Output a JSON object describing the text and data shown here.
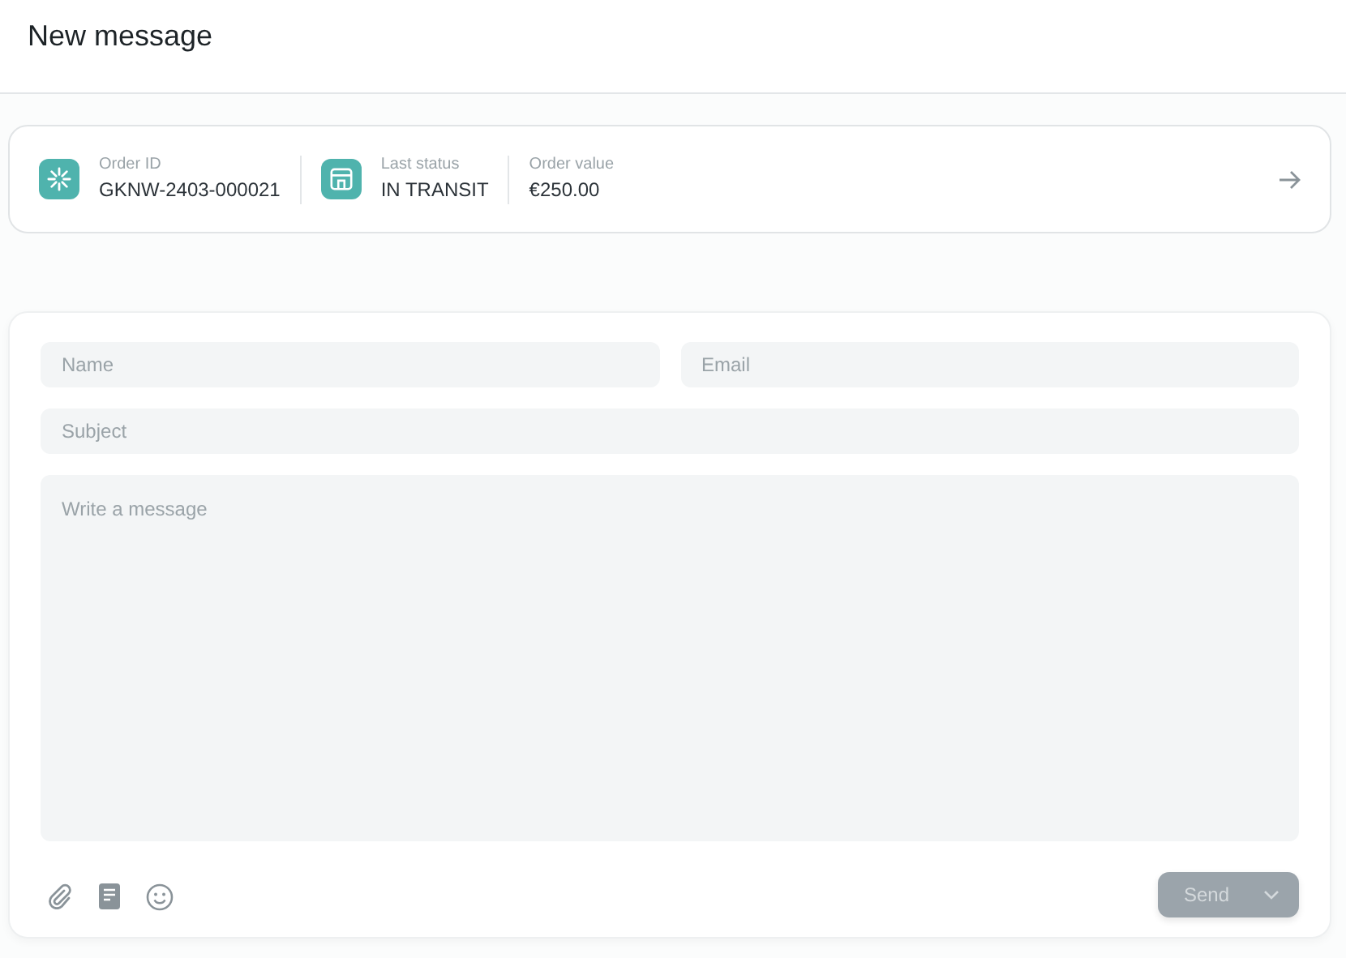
{
  "header": {
    "title": "New message"
  },
  "order": {
    "items": [
      {
        "kind": "id",
        "label": "Order ID",
        "value": "GKNW-2403-000021"
      },
      {
        "kind": "status",
        "label": "Last status",
        "value": "IN TRANSIT"
      },
      {
        "kind": "value",
        "label": "Order value",
        "value": "€250.00"
      }
    ]
  },
  "form": {
    "name": {
      "placeholder": "Name"
    },
    "email": {
      "placeholder": "Email"
    },
    "subject": {
      "placeholder": "Subject"
    },
    "message": {
      "placeholder": "Write a message"
    },
    "send": {
      "label": "Send",
      "disabled": true
    }
  }
}
